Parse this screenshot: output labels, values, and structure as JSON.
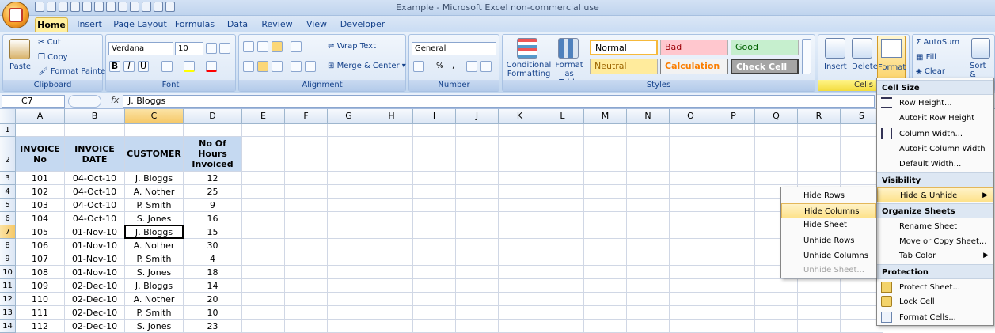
{
  "window": {
    "title": "Example - Microsoft Excel non-commercial use"
  },
  "tabs": [
    "Home",
    "Insert",
    "Page Layout",
    "Formulas",
    "Data",
    "Review",
    "View",
    "Developer"
  ],
  "ribbon": {
    "clipboard": {
      "label": "Clipboard",
      "paste": "Paste",
      "cut": "Cut",
      "copy": "Copy",
      "format_painter": "Format Painter"
    },
    "font": {
      "label": "Font",
      "font_name": "Verdana",
      "font_size": "10",
      "bold": "B",
      "italic": "I",
      "underline": "U"
    },
    "alignment": {
      "label": "Alignment",
      "wrap_text": "Wrap Text",
      "merge_center": "Merge & Center"
    },
    "number": {
      "label": "Number",
      "format": "General",
      "percent": "%",
      "comma": ","
    },
    "styles": {
      "label": "Styles",
      "conditional_formatting": "Conditional\nFormatting",
      "format_as_table": "Format\nas Table",
      "boxes": [
        {
          "text": "Normal",
          "bg": "#ffffff",
          "fg": "#000000"
        },
        {
          "text": "Bad",
          "bg": "#ffc7ce",
          "fg": "#9c0006"
        },
        {
          "text": "Good",
          "bg": "#c6efce",
          "fg": "#006100"
        },
        {
          "text": "Neutral",
          "bg": "#ffeb9c",
          "fg": "#9c6500"
        },
        {
          "text": "Calculation",
          "bg": "#f2f2f2",
          "fg": "#fa7d00"
        },
        {
          "text": "Check Cell",
          "bg": "#a5a5a5",
          "fg": "#ffffff"
        }
      ]
    },
    "cells": {
      "label": "Cells",
      "insert": "Insert",
      "delete": "Delete",
      "format": "Format"
    },
    "editing": {
      "autosum": "AutoSum",
      "fill": "Fill",
      "clear": "Clear",
      "sort_filter": "Sort &\nFilter"
    }
  },
  "formula_bar": {
    "name_box": "C7",
    "fx": "fx",
    "content": "J. Bloggs"
  },
  "sheet": {
    "columns": [
      "A",
      "B",
      "C",
      "D",
      "E",
      "F",
      "G",
      "H",
      "I",
      "J",
      "K",
      "L",
      "M",
      "N",
      "O",
      "P",
      "Q",
      "R",
      "S"
    ],
    "selected_column": "C",
    "selected_row": "7",
    "header_row": {
      "A": "INVOICE\nNo",
      "B": "INVOICE\nDATE",
      "C": "CUSTOMER",
      "D": "No Of\nHours\nInvoiced"
    },
    "rows": [
      {
        "n": "1",
        "cells": []
      },
      {
        "n": "2",
        "header": true
      },
      {
        "n": "3",
        "cells": [
          "101",
          "04-Oct-10",
          "J. Bloggs",
          "12"
        ]
      },
      {
        "n": "4",
        "cells": [
          "102",
          "04-Oct-10",
          "A. Nother",
          "25"
        ]
      },
      {
        "n": "5",
        "cells": [
          "103",
          "04-Oct-10",
          "P. Smith",
          "9"
        ]
      },
      {
        "n": "6",
        "cells": [
          "104",
          "04-Oct-10",
          "S. Jones",
          "16"
        ]
      },
      {
        "n": "7",
        "cells": [
          "105",
          "01-Nov-10",
          "J. Bloggs",
          "15"
        ]
      },
      {
        "n": "8",
        "cells": [
          "106",
          "01-Nov-10",
          "A. Nother",
          "30"
        ]
      },
      {
        "n": "9",
        "cells": [
          "107",
          "01-Nov-10",
          "P. Smith",
          "4"
        ]
      },
      {
        "n": "10",
        "cells": [
          "108",
          "01-Nov-10",
          "S. Jones",
          "18"
        ]
      },
      {
        "n": "11",
        "cells": [
          "109",
          "02-Dec-10",
          "J. Bloggs",
          "14"
        ]
      },
      {
        "n": "12",
        "cells": [
          "110",
          "02-Dec-10",
          "A. Nother",
          "20"
        ]
      },
      {
        "n": "13",
        "cells": [
          "111",
          "02-Dec-10",
          "P. Smith",
          "10"
        ]
      },
      {
        "n": "14",
        "cells": [
          "112",
          "02-Dec-10",
          "S. Jones",
          "23"
        ]
      }
    ]
  },
  "format_menu": {
    "cell_size_header": "Cell Size",
    "row_height": "Row Height...",
    "autofit_row_height": "AutoFit Row Height",
    "column_width": "Column Width...",
    "autofit_column_width": "AutoFit Column Width",
    "default_width": "Default Width...",
    "visibility_header": "Visibility",
    "hide_unhide": "Hide & Unhide",
    "organize_header": "Organize Sheets",
    "rename_sheet": "Rename Sheet",
    "move_copy_sheet": "Move or Copy Sheet...",
    "tab_color": "Tab Color",
    "protection_header": "Protection",
    "protect_sheet": "Protect Sheet...",
    "lock_cell": "Lock Cell",
    "format_cells": "Format Cells..."
  },
  "hide_menu": {
    "hide_rows": "Hide Rows",
    "hide_columns": "Hide Columns",
    "hide_sheet": "Hide Sheet",
    "unhide_rows": "Unhide Rows",
    "unhide_columns": "Unhide Columns",
    "unhide_sheet": "Unhide Sheet..."
  }
}
